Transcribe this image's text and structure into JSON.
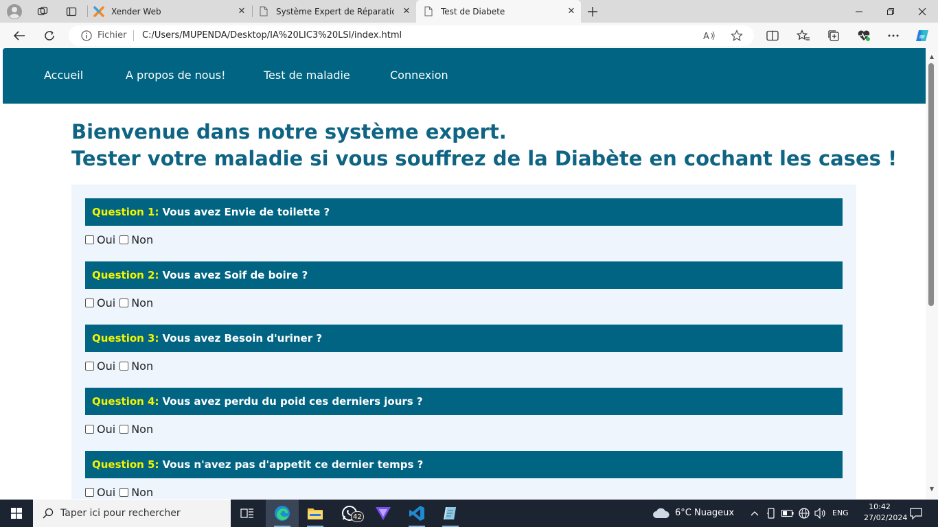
{
  "browser": {
    "tabs": [
      {
        "title": "Xender Web",
        "active": false
      },
      {
        "title": "Système Expert de Réparation d'I",
        "active": false
      },
      {
        "title": "Test de Diabete",
        "active": true
      }
    ],
    "address": {
      "label": "Fichier",
      "url": "C:/Users/MUPENDA/Desktop/IA%20LIC3%20LSI/index.html"
    }
  },
  "site": {
    "nav": [
      "Accueil",
      "A propos de nous!",
      "Test de maladie",
      "Connexion"
    ],
    "title_line1": "Bienvenue dans notre système expert.",
    "title_line2": "Tester votre maladie si vous souffrez de la Diabète en cochant les cases !",
    "answer_yes": "Oui",
    "answer_no": "Non",
    "questions": [
      {
        "label": "Question 1:",
        "text": "Vous avez Envie de toilette ?"
      },
      {
        "label": "Question 2:",
        "text": "Vous avez Soif de boire ?"
      },
      {
        "label": "Question 3:",
        "text": "Vous avez Besoin d'uriner ?"
      },
      {
        "label": "Question 4:",
        "text": "Vous avez perdu du poid ces derniers jours ?"
      },
      {
        "label": "Question 5:",
        "text": "Vous n'avez pas d'appetit ce dernier temps ?"
      }
    ]
  },
  "taskbar": {
    "search_placeholder": "Taper ici pour rechercher",
    "whatsapp_badge": "42",
    "weather": "6°C  Nuageux",
    "lang": "ENG",
    "time": "10:42",
    "date": "27/02/2024"
  },
  "colors": {
    "nav_bg": "#006482",
    "title": "#0e6482",
    "question_label": "#f4f400",
    "quiz_bg": "#eef5fd"
  }
}
